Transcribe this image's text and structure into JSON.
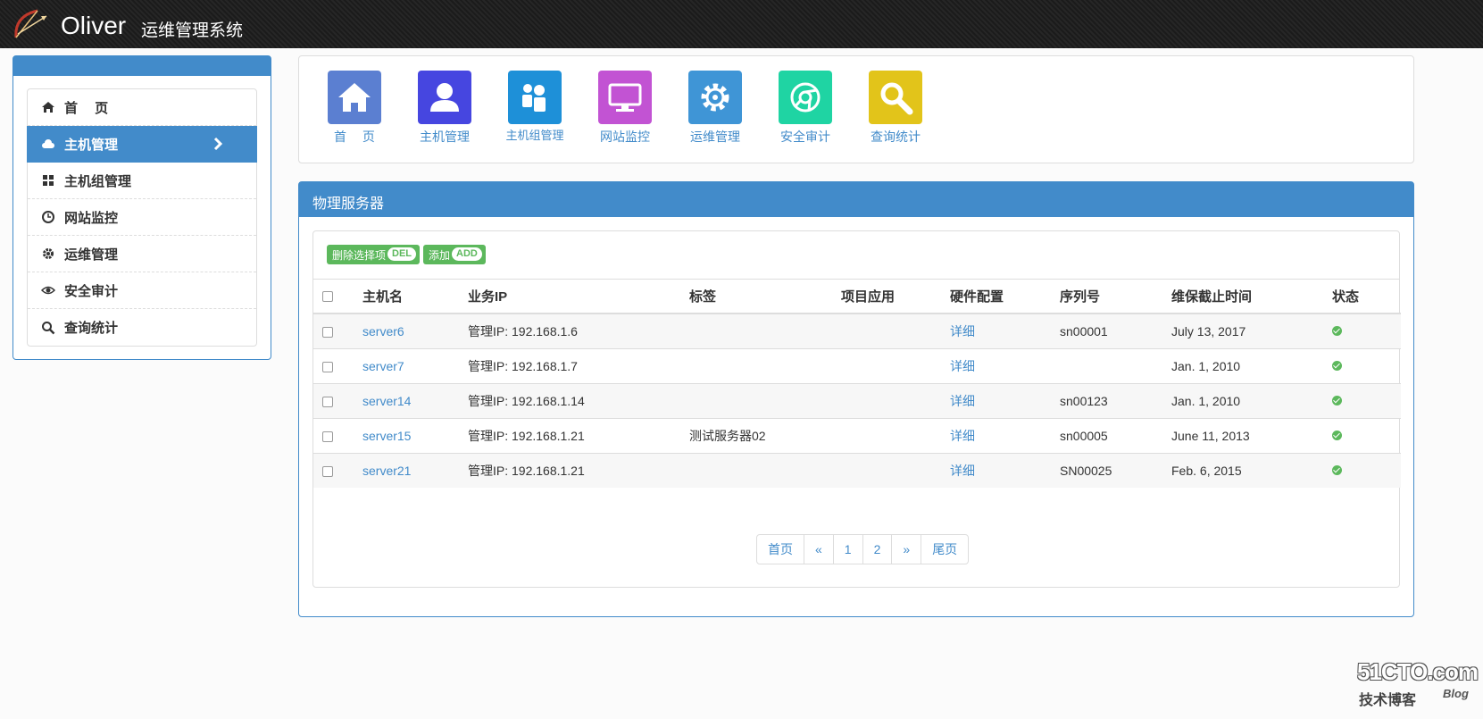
{
  "header": {
    "brand": "Oliver",
    "subtitle": "运维管理系统"
  },
  "sidebar": {
    "items": [
      {
        "label": "首　 页",
        "icon": "home-icon"
      },
      {
        "label": "主机管理",
        "icon": "cloud-icon",
        "active": true
      },
      {
        "label": "主机组管理",
        "icon": "grid-icon"
      },
      {
        "label": "网站监控",
        "icon": "clock-icon"
      },
      {
        "label": "运维管理",
        "icon": "gear-icon"
      },
      {
        "label": "安全审计",
        "icon": "eye-icon"
      },
      {
        "label": "查询统计",
        "icon": "search-icon"
      }
    ]
  },
  "tiles": [
    {
      "label": "首　 页",
      "color": "#5b7fd1",
      "icon": "home-icon"
    },
    {
      "label": "主机管理",
      "color": "#4646e0",
      "icon": "user-icon"
    },
    {
      "label": "主机组管理",
      "color": "#1e90d8",
      "icon": "group-icon"
    },
    {
      "label": "网站监控",
      "color": "#c253d3",
      "icon": "monitor-icon"
    },
    {
      "label": "运维管理",
      "color": "#3f95d6",
      "icon": "gear-icon"
    },
    {
      "label": "安全审计",
      "color": "#1fd4a3",
      "icon": "chrome-icon"
    },
    {
      "label": "查询统计",
      "color": "#e2c41a",
      "icon": "search-icon"
    }
  ],
  "panel": {
    "title": "物理服务器",
    "delete_label": "删除选择项",
    "delete_tag": "DEL",
    "add_label": "添加",
    "add_tag": "ADD"
  },
  "table": {
    "headers": [
      "主机名",
      "业务IP",
      "标签",
      "项目应用",
      "硬件配置",
      "序列号",
      "维保截止时间",
      "状态"
    ],
    "rows": [
      {
        "host": "server6",
        "ip": "管理IP: 192.168.1.6",
        "tag": "",
        "app": "",
        "hw": "详细",
        "sn": "sn00001",
        "warranty": "July 13, 2017"
      },
      {
        "host": "server7",
        "ip": "管理IP: 192.168.1.7",
        "tag": "",
        "app": "",
        "hw": "详细",
        "sn": "",
        "warranty": "Jan. 1, 2010"
      },
      {
        "host": "server14",
        "ip": "管理IP: 192.168.1.14",
        "tag": "",
        "app": "",
        "hw": "详细",
        "sn": "sn00123",
        "warranty": "Jan. 1, 2010"
      },
      {
        "host": "server15",
        "ip": "管理IP: 192.168.1.21",
        "tag": "测试服务器02",
        "app": "",
        "hw": "详细",
        "sn": "sn00005",
        "warranty": "June 11, 2013"
      },
      {
        "host": "server21",
        "ip": "管理IP: 192.168.1.21",
        "tag": "",
        "app": "",
        "hw": "详细",
        "sn": "SN00025",
        "warranty": "Feb. 6, 2015"
      }
    ]
  },
  "pager": {
    "first": "首页",
    "prev": "«",
    "p1": "1",
    "p2": "2",
    "next": "»",
    "last": "尾页"
  },
  "watermark": {
    "site": "51CTO.com",
    "sub": "技术博客",
    "blog": "Blog"
  }
}
